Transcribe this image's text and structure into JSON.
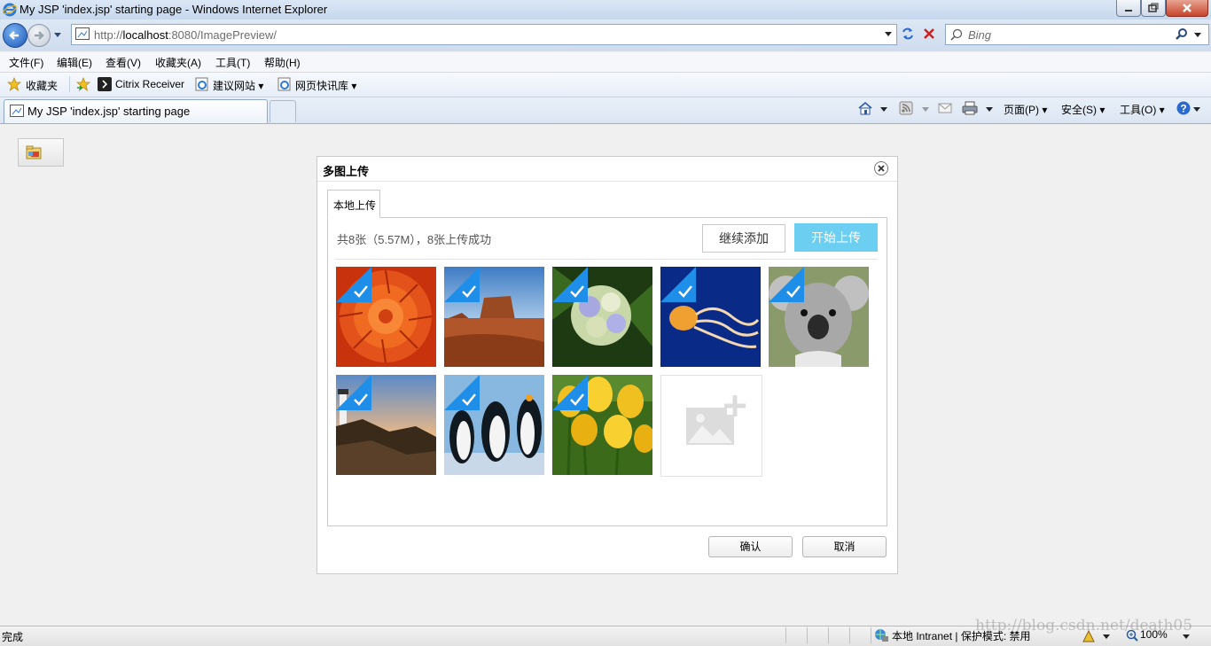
{
  "window": {
    "title": "My JSP 'index.jsp' starting page - Windows Internet Explorer"
  },
  "address_bar": {
    "url_prefix": "http://",
    "url_host": "localhost",
    "url_rest": ":8080/ImagePreview/",
    "search_placeholder": "Bing"
  },
  "menu": {
    "items": [
      "文件(F)",
      "编辑(E)",
      "查看(V)",
      "收藏夹(A)",
      "工具(T)",
      "帮助(H)"
    ]
  },
  "favorites_bar": {
    "favorites_label": "收藏夹",
    "items": [
      "Citrix Receiver",
      "建议网站 ▾",
      "网页快讯库 ▾"
    ]
  },
  "tabs": {
    "active_label": "My JSP 'index.jsp' starting page"
  },
  "command_bar": {
    "page_label": "页面(P) ▾",
    "safety_label": "安全(S) ▾",
    "tools_label": "工具(O) ▾"
  },
  "dialog": {
    "title": "多图上传",
    "tab_label": "本地上传",
    "summary": "共8张（5.57M），8张上传成功",
    "continue_button": "继续添加",
    "start_button": "开始上传",
    "images": [
      {
        "name": "chrysanthemum",
        "uploaded": true
      },
      {
        "name": "desert",
        "uploaded": true
      },
      {
        "name": "hydrangeas",
        "uploaded": true
      },
      {
        "name": "jellyfish",
        "uploaded": true
      },
      {
        "name": "koala",
        "uploaded": true
      },
      {
        "name": "lighthouse",
        "uploaded": true
      },
      {
        "name": "penguins",
        "uploaded": true
      },
      {
        "name": "tulips",
        "uploaded": true
      }
    ],
    "confirm_button": "确认",
    "cancel_button": "取消"
  },
  "status_bar": {
    "status": "完成",
    "zone": "本地 Intranet | 保护模式: 禁用",
    "zoom": "100%",
    "watermark": "http://blog.csdn.net/death05"
  },
  "colors": {
    "accent": "#6ccef0",
    "check": "#1e8ee8"
  }
}
